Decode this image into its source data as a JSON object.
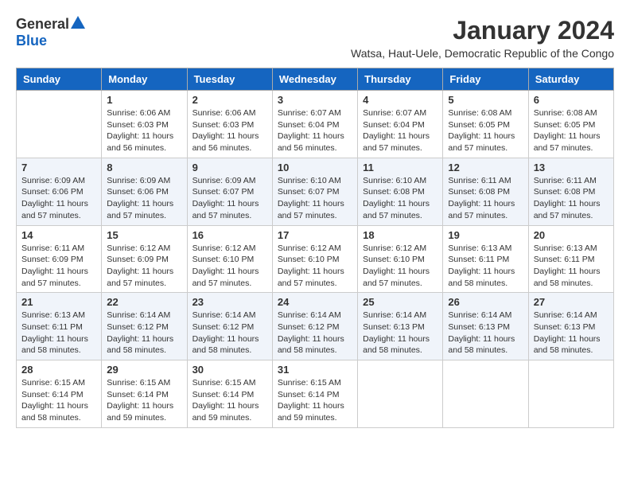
{
  "logo": {
    "general": "General",
    "blue": "Blue"
  },
  "title": "January 2024",
  "subtitle": "Watsa, Haut-Uele, Democratic Republic of the Congo",
  "headers": [
    "Sunday",
    "Monday",
    "Tuesday",
    "Wednesday",
    "Thursday",
    "Friday",
    "Saturday"
  ],
  "weeks": [
    [
      {
        "day": "",
        "info": ""
      },
      {
        "day": "1",
        "info": "Sunrise: 6:06 AM\nSunset: 6:03 PM\nDaylight: 11 hours\nand 56 minutes."
      },
      {
        "day": "2",
        "info": "Sunrise: 6:06 AM\nSunset: 6:03 PM\nDaylight: 11 hours\nand 56 minutes."
      },
      {
        "day": "3",
        "info": "Sunrise: 6:07 AM\nSunset: 6:04 PM\nDaylight: 11 hours\nand 56 minutes."
      },
      {
        "day": "4",
        "info": "Sunrise: 6:07 AM\nSunset: 6:04 PM\nDaylight: 11 hours\nand 57 minutes."
      },
      {
        "day": "5",
        "info": "Sunrise: 6:08 AM\nSunset: 6:05 PM\nDaylight: 11 hours\nand 57 minutes."
      },
      {
        "day": "6",
        "info": "Sunrise: 6:08 AM\nSunset: 6:05 PM\nDaylight: 11 hours\nand 57 minutes."
      }
    ],
    [
      {
        "day": "7",
        "info": "Sunrise: 6:09 AM\nSunset: 6:06 PM\nDaylight: 11 hours\nand 57 minutes."
      },
      {
        "day": "8",
        "info": "Sunrise: 6:09 AM\nSunset: 6:06 PM\nDaylight: 11 hours\nand 57 minutes."
      },
      {
        "day": "9",
        "info": "Sunrise: 6:09 AM\nSunset: 6:07 PM\nDaylight: 11 hours\nand 57 minutes."
      },
      {
        "day": "10",
        "info": "Sunrise: 6:10 AM\nSunset: 6:07 PM\nDaylight: 11 hours\nand 57 minutes."
      },
      {
        "day": "11",
        "info": "Sunrise: 6:10 AM\nSunset: 6:08 PM\nDaylight: 11 hours\nand 57 minutes."
      },
      {
        "day": "12",
        "info": "Sunrise: 6:11 AM\nSunset: 6:08 PM\nDaylight: 11 hours\nand 57 minutes."
      },
      {
        "day": "13",
        "info": "Sunrise: 6:11 AM\nSunset: 6:08 PM\nDaylight: 11 hours\nand 57 minutes."
      }
    ],
    [
      {
        "day": "14",
        "info": "Sunrise: 6:11 AM\nSunset: 6:09 PM\nDaylight: 11 hours\nand 57 minutes."
      },
      {
        "day": "15",
        "info": "Sunrise: 6:12 AM\nSunset: 6:09 PM\nDaylight: 11 hours\nand 57 minutes."
      },
      {
        "day": "16",
        "info": "Sunrise: 6:12 AM\nSunset: 6:10 PM\nDaylight: 11 hours\nand 57 minutes."
      },
      {
        "day": "17",
        "info": "Sunrise: 6:12 AM\nSunset: 6:10 PM\nDaylight: 11 hours\nand 57 minutes."
      },
      {
        "day": "18",
        "info": "Sunrise: 6:12 AM\nSunset: 6:10 PM\nDaylight: 11 hours\nand 57 minutes."
      },
      {
        "day": "19",
        "info": "Sunrise: 6:13 AM\nSunset: 6:11 PM\nDaylight: 11 hours\nand 58 minutes."
      },
      {
        "day": "20",
        "info": "Sunrise: 6:13 AM\nSunset: 6:11 PM\nDaylight: 11 hours\nand 58 minutes."
      }
    ],
    [
      {
        "day": "21",
        "info": "Sunrise: 6:13 AM\nSunset: 6:11 PM\nDaylight: 11 hours\nand 58 minutes."
      },
      {
        "day": "22",
        "info": "Sunrise: 6:14 AM\nSunset: 6:12 PM\nDaylight: 11 hours\nand 58 minutes."
      },
      {
        "day": "23",
        "info": "Sunrise: 6:14 AM\nSunset: 6:12 PM\nDaylight: 11 hours\nand 58 minutes."
      },
      {
        "day": "24",
        "info": "Sunrise: 6:14 AM\nSunset: 6:12 PM\nDaylight: 11 hours\nand 58 minutes."
      },
      {
        "day": "25",
        "info": "Sunrise: 6:14 AM\nSunset: 6:13 PM\nDaylight: 11 hours\nand 58 minutes."
      },
      {
        "day": "26",
        "info": "Sunrise: 6:14 AM\nSunset: 6:13 PM\nDaylight: 11 hours\nand 58 minutes."
      },
      {
        "day": "27",
        "info": "Sunrise: 6:14 AM\nSunset: 6:13 PM\nDaylight: 11 hours\nand 58 minutes."
      }
    ],
    [
      {
        "day": "28",
        "info": "Sunrise: 6:15 AM\nSunset: 6:14 PM\nDaylight: 11 hours\nand 58 minutes."
      },
      {
        "day": "29",
        "info": "Sunrise: 6:15 AM\nSunset: 6:14 PM\nDaylight: 11 hours\nand 59 minutes."
      },
      {
        "day": "30",
        "info": "Sunrise: 6:15 AM\nSunset: 6:14 PM\nDaylight: 11 hours\nand 59 minutes."
      },
      {
        "day": "31",
        "info": "Sunrise: 6:15 AM\nSunset: 6:14 PM\nDaylight: 11 hours\nand 59 minutes."
      },
      {
        "day": "",
        "info": ""
      },
      {
        "day": "",
        "info": ""
      },
      {
        "day": "",
        "info": ""
      }
    ]
  ]
}
